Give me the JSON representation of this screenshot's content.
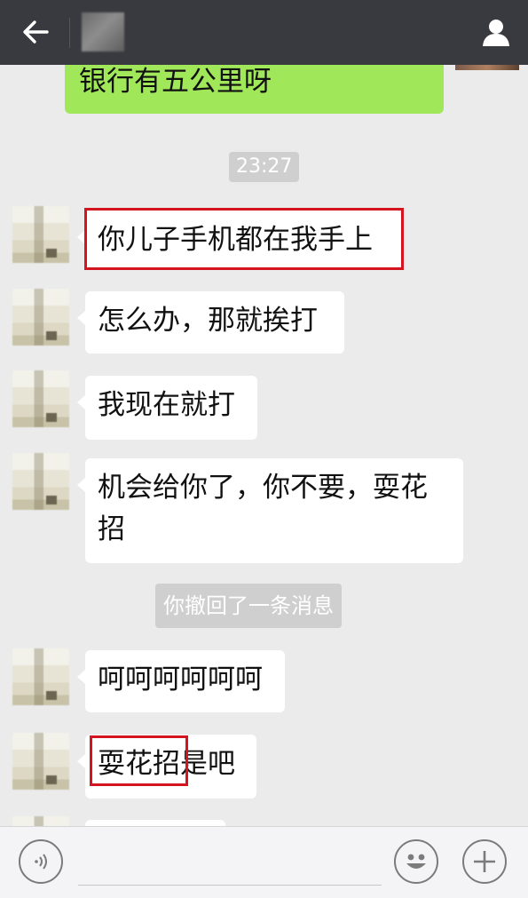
{
  "header": {
    "back_icon": "arrow-left-icon",
    "profile_icon": "person-icon",
    "bg_color": "#393a3f"
  },
  "messages": {
    "sent_top": "银行有五公里呀",
    "timestamp": "23:27",
    "m1": "你儿子手机都在我手上",
    "m2": "怎么办，那就挨打",
    "m3": "我现在就打",
    "m4_line1": "机会给你了，你不要，耍花",
    "m4_line2": "招",
    "system_recall": "你撤回了一条消息",
    "m5": "呵呵呵呵呵呵",
    "m6_part1": "耍花招",
    "m6_part2": "是吧"
  },
  "highlight_color": "#d4141e",
  "bubble_sent_color": "#a0e75a",
  "footer": {
    "voice_icon": "voice-icon",
    "emoji_icon": "smiley-icon",
    "plus_icon": "plus-icon"
  }
}
